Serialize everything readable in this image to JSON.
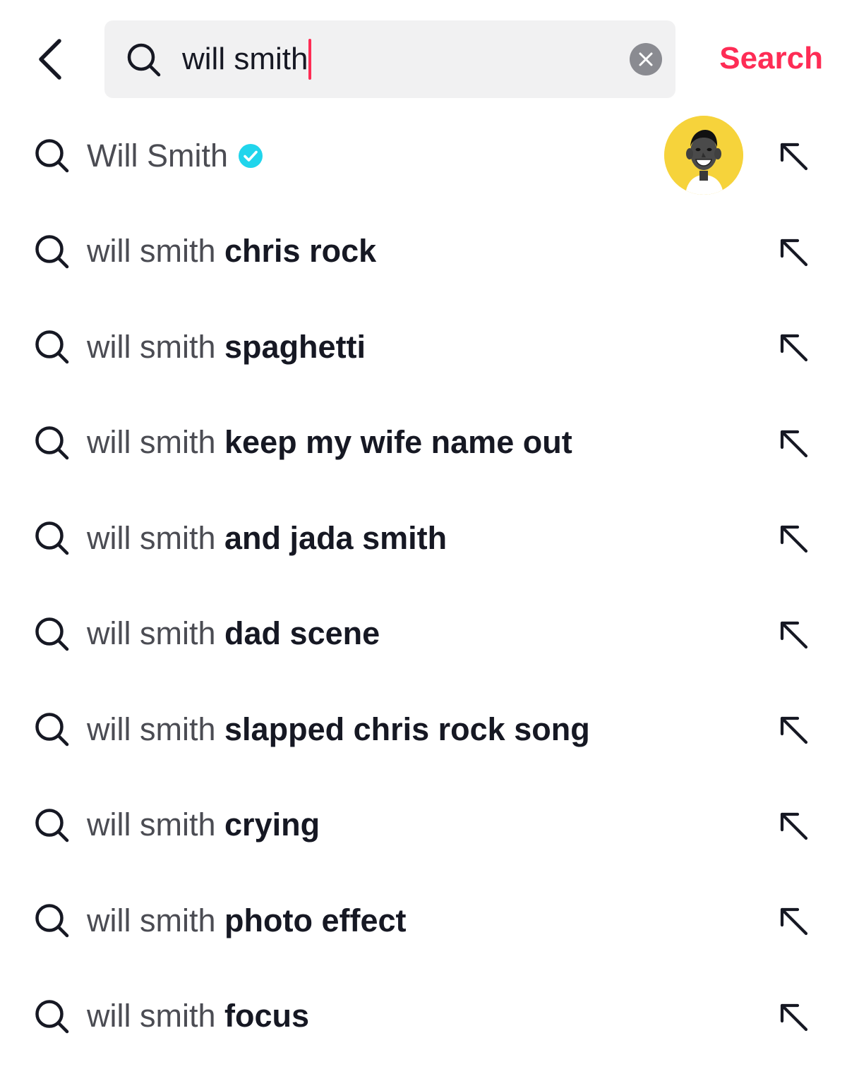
{
  "header": {
    "back_icon": "chevron-left-icon",
    "search_icon": "search-icon",
    "query": "will smith",
    "clear_icon": "clear-x-icon",
    "search_label": "Search"
  },
  "colors": {
    "accent": "#fe2c55",
    "search_bg": "#f1f1f2",
    "verified": "#20d5ec",
    "avatar_bg": "#f6d33b",
    "text_primary": "#161823",
    "text_secondary": "#4b4c53"
  },
  "user_suggestion": {
    "name": "Will Smith",
    "verified": true,
    "verified_icon": "verified-badge-icon",
    "avatar_icon": "avatar"
  },
  "suggestions": [
    {
      "prefix": "will smith",
      "suffix": "chris rock"
    },
    {
      "prefix": "will smith",
      "suffix": "spaghetti"
    },
    {
      "prefix": "will smith",
      "suffix": "keep my wife name out"
    },
    {
      "prefix": "will smith",
      "suffix": "and jada smith"
    },
    {
      "prefix": "will smith",
      "suffix": "dad scene"
    },
    {
      "prefix": "will smith",
      "suffix": "slapped chris rock song"
    },
    {
      "prefix": "will smith",
      "suffix": "crying"
    },
    {
      "prefix": "will smith",
      "suffix": "photo effect"
    },
    {
      "prefix": "will smith",
      "suffix": "focus"
    }
  ],
  "row_icons": {
    "search": "search-icon",
    "fill_arrow": "arrow-up-left-icon"
  }
}
